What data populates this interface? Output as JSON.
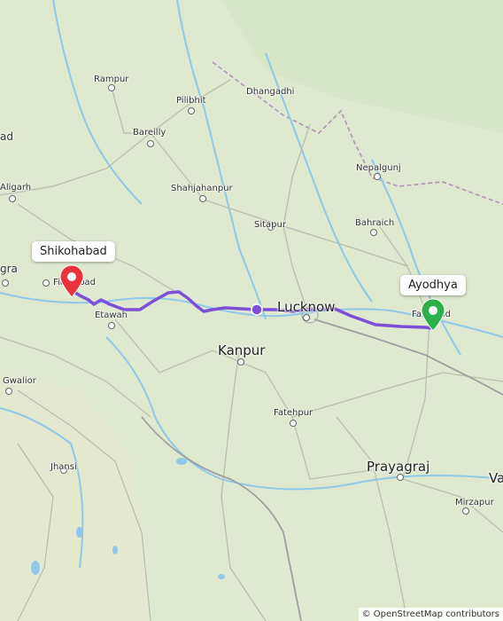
{
  "map": {
    "route_color": "#7b4fd6",
    "start_pin_color": "#e8323c",
    "end_pin_color": "#2bb04a",
    "start_label": "Shikohabad",
    "end_label": "Ayodhya",
    "attribution": "© OpenStreetMap contributors",
    "places": {
      "rampur": "Rampur",
      "pilibhit": "Pilibhit",
      "dhangadhi": "Dhangadhi",
      "bareilly": "Bareilly",
      "aligarh": "Aligarh",
      "shahjahanpur": "Shahjahanpur",
      "nepalgunj": "Nepalgunj",
      "bahraich": "Bahraich",
      "sitapur": "Sitapur",
      "etawah": "Etawah",
      "lucknow": "Lucknow",
      "kanpur": "Kanpur",
      "faizabad": "Faizabad",
      "firozabad": "Firozabad",
      "agra": "gra",
      "moradabad": "ad",
      "gwalior": "Gwalior",
      "fatehpur": "Fatehpur",
      "jhansi": "Jhansi",
      "prayagraj": "Prayagraj",
      "mirzapur": "Mirzapur",
      "varanasi": "Va"
    }
  }
}
